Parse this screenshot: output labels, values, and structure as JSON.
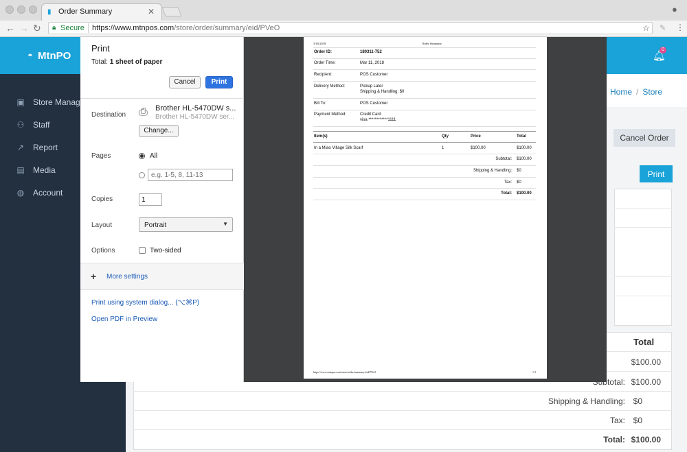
{
  "browser": {
    "tab_title": "Order Summary",
    "secure_label": "Secure",
    "url_host": "https://www.mtnpos.com",
    "url_path": "/store/order/summary/eid/PVeO"
  },
  "app": {
    "brand": "MtnPO",
    "notification_count": "0",
    "sidebar": [
      {
        "label": "Store Manage",
        "icon": "briefcase-icon"
      },
      {
        "label": "Staff",
        "icon": "users-icon"
      },
      {
        "label": "Report",
        "icon": "trend-icon"
      },
      {
        "label": "Media",
        "icon": "image-icon"
      },
      {
        "label": "Account",
        "icon": "globe-icon"
      }
    ],
    "breadcrumb": [
      "Home",
      "Store"
    ],
    "cancel_order": "Cancel Order",
    "print": "Print",
    "totals": {
      "header": "Total",
      "item_total": "$100.00",
      "subtotal_label": "Subtotal:",
      "subtotal": "$100.00",
      "shipping_label": "Shipping & Handling:",
      "shipping": "$0",
      "tax_label": "Tax:",
      "tax": "$0",
      "total_label": "Total:",
      "total": "$100.00"
    }
  },
  "dialog": {
    "title": "Print",
    "total_prefix": "Total:",
    "total_value": "1 sheet of paper",
    "cancel": "Cancel",
    "print": "Print",
    "destination_label": "Destination",
    "printer_name": "Brother HL-5470DW s...",
    "printer_sub": "Brother HL-5470DW ser...",
    "change": "Change...",
    "pages_label": "Pages",
    "pages_all": "All",
    "pages_placeholder": "e.g. 1-5, 8, 11-13",
    "copies_label": "Copies",
    "copies_value": "1",
    "layout_label": "Layout",
    "layout_value": "Portrait",
    "options_label": "Options",
    "two_sided": "Two-sided",
    "more_settings": "More settings",
    "system_dialog": "Print using system dialog... (⌥⌘P)",
    "open_pdf": "Open PDF in Preview"
  },
  "preview": {
    "date": "3/16/2018",
    "header_title": "Order Summary",
    "fields": [
      {
        "label": "Order ID:",
        "value": "180311-752",
        "bold": true
      },
      {
        "label": "Order Time:",
        "value": "Mar 11, 2018"
      },
      {
        "label": "Recipient:",
        "value": "POS Customer"
      },
      {
        "label": "Delivery Method:",
        "value": "Pickup Later",
        "value2": "Shipping & Handling: $0"
      },
      {
        "label": "Bill To:",
        "value": "POS Customer"
      },
      {
        "label": "Payment Method:",
        "value": "Credit Card",
        "value2": "visa ************1111"
      }
    ],
    "cols": [
      "Item(s)",
      "Qty",
      "Price",
      "Total"
    ],
    "item": {
      "name": "In a Miao Village Silk Scarf",
      "qty": "1",
      "price": "$100.00",
      "total": "$100.00"
    },
    "subtotal_label": "Subtotal:",
    "subtotal": "$100.00",
    "shipping_label": "Shipping & Handling:",
    "shipping": "$0",
    "tax_label": "Tax:",
    "tax": "$0",
    "total_label": "Total:",
    "total": "$100.00",
    "footer_url": "https://www.mtnpos.com/store/order/summary/eid/PVeO",
    "footer_page": "1/1"
  }
}
